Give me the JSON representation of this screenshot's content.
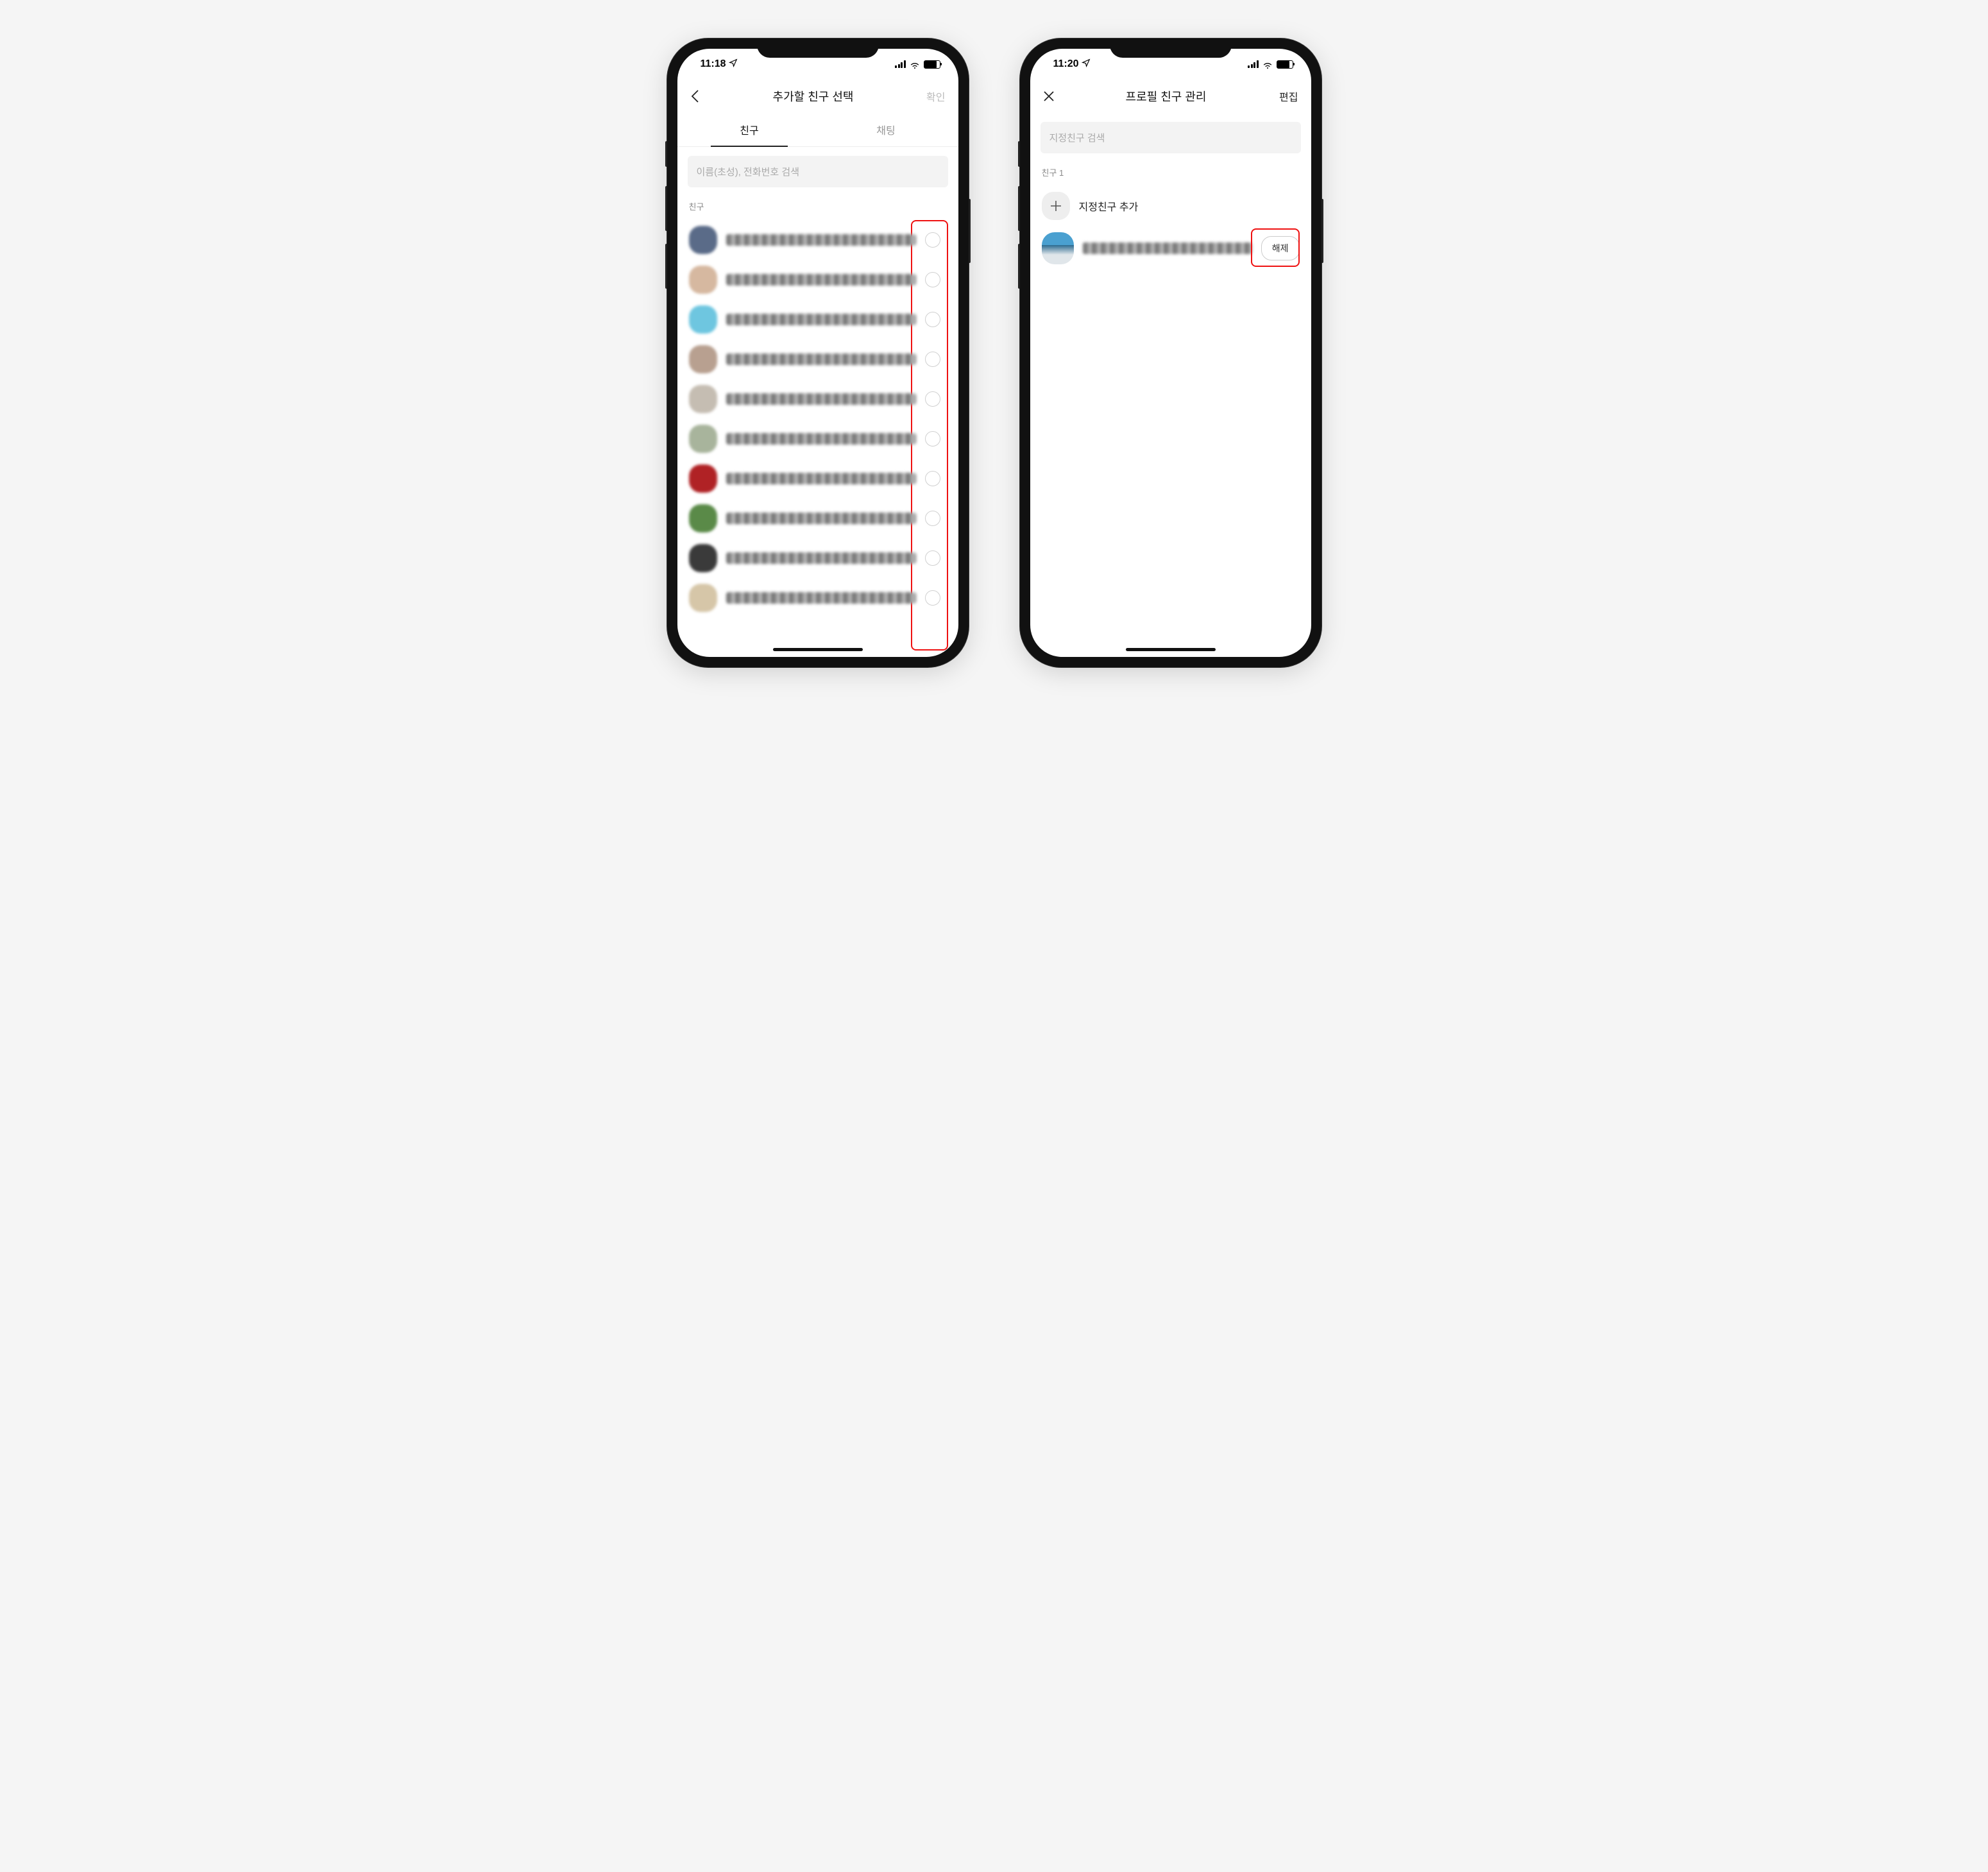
{
  "left": {
    "status_time": "11:18",
    "title": "추가할 친구 선택",
    "confirm": "확인",
    "tab_friends": "친구",
    "tab_chat": "채팅",
    "search_placeholder": "이름(초성), 전화번호 검색",
    "section": "친구",
    "rows": 10,
    "avatar_colors": [
      "#5a6b88",
      "#d6b8a0",
      "#6ec6e0",
      "#b8a090",
      "#c5bdb2",
      "#a8b49c",
      "#b02225",
      "#5a8a48",
      "#3a3a3a",
      "#d6c6a8"
    ]
  },
  "right": {
    "status_time": "11:20",
    "title": "프로필 친구 관리",
    "edit": "편집",
    "search_placeholder": "지정친구 검색",
    "section": "친구 1",
    "add_label": "지정친구 추가",
    "remove": "해제"
  }
}
